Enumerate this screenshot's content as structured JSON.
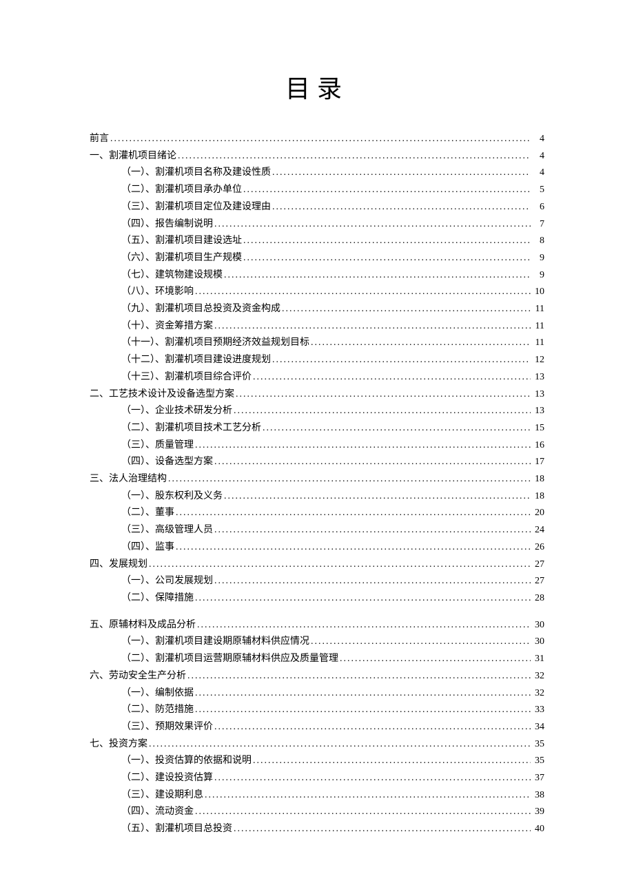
{
  "title": "目录",
  "entries": [
    {
      "level": 0,
      "label": "前言",
      "page": "4",
      "gap": false
    },
    {
      "level": 0,
      "label": "一、割灌机项目绪论",
      "page": "4",
      "gap": false
    },
    {
      "level": 1,
      "label": "（一）、割灌机项目名称及建设性质",
      "page": "4",
      "gap": false
    },
    {
      "level": 1,
      "label": "（二）、割灌机项目承办单位",
      "page": "5",
      "gap": false
    },
    {
      "level": 1,
      "label": "（三）、割灌机项目定位及建设理由",
      "page": "6",
      "gap": false
    },
    {
      "level": 1,
      "label": "（四）、报告编制说明",
      "page": "7",
      "gap": false
    },
    {
      "level": 1,
      "label": "（五）、割灌机项目建设选址",
      "page": "8",
      "gap": false
    },
    {
      "level": 1,
      "label": "（六）、割灌机项目生产规模",
      "page": "9",
      "gap": false
    },
    {
      "level": 1,
      "label": "（七）、建筑物建设规模",
      "page": "9",
      "gap": false
    },
    {
      "level": 1,
      "label": "（八）、环境影响",
      "page": "10",
      "gap": false
    },
    {
      "level": 1,
      "label": "（九）、割灌机项目总投资及资金构成",
      "page": "11",
      "gap": false
    },
    {
      "level": 1,
      "label": "（十）、资金筹措方案",
      "page": "11",
      "gap": false
    },
    {
      "level": 1,
      "label": "（十一）、割灌机项目预期经济效益规划目标",
      "page": "11",
      "gap": false
    },
    {
      "level": 1,
      "label": "（十二）、割灌机项目建设进度规划",
      "page": "12",
      "gap": false
    },
    {
      "level": 1,
      "label": "（十三）、割灌机项目综合评价",
      "page": "13",
      "gap": false
    },
    {
      "level": 0,
      "label": "二、工艺技术设计及设备选型方案",
      "page": "13",
      "gap": false
    },
    {
      "level": 1,
      "label": "（一）、企业技术研发分析",
      "page": "13",
      "gap": false
    },
    {
      "level": 1,
      "label": "（二）、割灌机项目技术工艺分析",
      "page": "15",
      "gap": false
    },
    {
      "level": 1,
      "label": "（三）、质量管理",
      "page": "16",
      "gap": false
    },
    {
      "level": 1,
      "label": "（四）、设备选型方案",
      "page": "17",
      "gap": false
    },
    {
      "level": 0,
      "label": "三、法人治理结构",
      "page": "18",
      "gap": false
    },
    {
      "level": 1,
      "label": "（一）、股东权利及义务",
      "page": "18",
      "gap": false
    },
    {
      "level": 1,
      "label": "（二）、董事",
      "page": "20",
      "gap": false
    },
    {
      "level": 1,
      "label": "（三）、高级管理人员",
      "page": "24",
      "gap": false
    },
    {
      "level": 1,
      "label": "（四）、监事",
      "page": "26",
      "gap": false
    },
    {
      "level": 0,
      "label": "四、发展规划",
      "page": "27",
      "gap": false
    },
    {
      "level": 1,
      "label": "（一）、公司发展规划",
      "page": "27",
      "gap": false
    },
    {
      "level": 1,
      "label": "（二）、保障措施",
      "page": "28",
      "gap": false
    },
    {
      "level": 0,
      "label": "五、原辅材料及成品分析",
      "page": "30",
      "gap": true
    },
    {
      "level": 1,
      "label": "（一）、割灌机项目建设期原辅材料供应情况",
      "page": "30",
      "gap": false
    },
    {
      "level": 1,
      "label": "（二）、割灌机项目运营期原辅材料供应及质量管理",
      "page": "31",
      "gap": false
    },
    {
      "level": 0,
      "label": "六、劳动安全生产分析",
      "page": "32",
      "gap": false
    },
    {
      "level": 1,
      "label": "（一）、编制依据",
      "page": "32",
      "gap": false
    },
    {
      "level": 1,
      "label": "（二）、防范措施",
      "page": "33",
      "gap": false
    },
    {
      "level": 1,
      "label": "（三）、预期效果评价",
      "page": "34",
      "gap": false
    },
    {
      "level": 0,
      "label": "七、投资方案",
      "page": "35",
      "gap": false
    },
    {
      "level": 1,
      "label": "（一）、投资估算的依据和说明",
      "page": "35",
      "gap": false
    },
    {
      "level": 1,
      "label": "（二）、建设投资估算",
      "page": "37",
      "gap": false
    },
    {
      "level": 1,
      "label": "（三）、建设期利息",
      "page": "38",
      "gap": false
    },
    {
      "level": 1,
      "label": "（四）、流动资金",
      "page": "39",
      "gap": false
    },
    {
      "level": 1,
      "label": "（五）、割灌机项目总投资",
      "page": "40",
      "gap": false
    }
  ]
}
